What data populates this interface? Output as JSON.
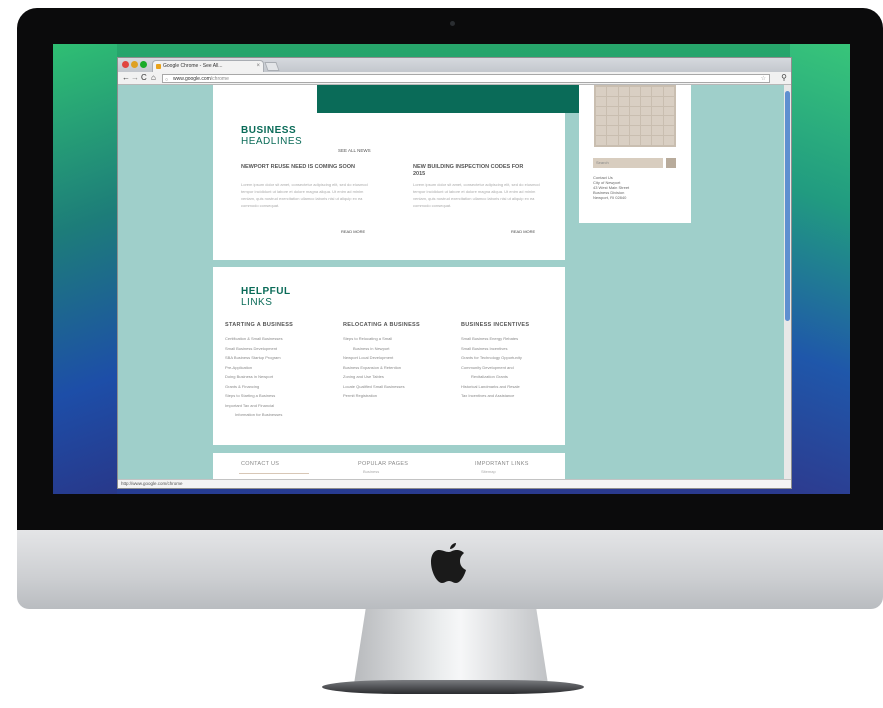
{
  "browser": {
    "tab_title": "Google Chrome - See All...",
    "url_host": "www.google.com",
    "url_path": "/chrome",
    "status_url": "http://www.google.com/chrome"
  },
  "headlines": {
    "title_bold": "BUSINESS",
    "title_light": "HEADLINES",
    "see_all": "SEE ALL NEWS",
    "articles": [
      {
        "title": "NEWPORT REUSE NEED IS COMING SOON",
        "body": "Lorem ipsum dolor sit amet, consectetur adipiscing elit, sed do eiusmod tempor incididunt ut labore et dolore magna aliqua. Ut enim ad minim veniam, quis nostrud exercitation ullamco laboris nisi ut aliquip ex ea commodo consequat.",
        "read_more": "READ MORE"
      },
      {
        "title": "NEW BUILDING INSPECTION CODES FOR 2015",
        "body": "Lorem ipsum dolor sit amet, consectetur adipiscing elit, sed do eiusmod tempor incididunt ut labore et dolore magna aliqua. Ut enim ad minim veniam, quis nostrud exercitation ullamco laboris nisi ut aliquip ex ea commodo consequat.",
        "read_more": "READ MORE"
      }
    ]
  },
  "helpful": {
    "title_bold": "HELPFUL",
    "title_light": "LINKS",
    "columns": [
      {
        "title": "STARTING A BUSINESS",
        "links": [
          "Certification & Small Businesses",
          "Small Business Development",
          "SBA Business Startup Program",
          "Pre-Application",
          "Doing Business in Newport",
          "Grants & Financing",
          "Steps to Starting a Business",
          "Important Tax and Financial",
          "Information for Businesses"
        ]
      },
      {
        "title": "RELOCATING A BUSINESS",
        "links": [
          "Steps to Relocating a Small",
          "Business in Newport",
          "Newport Local Development",
          "Business Expansion & Retention",
          "Zoning and Use Tables",
          "Locate Qualified Small Businesses",
          "Permit Registration"
        ]
      },
      {
        "title": "BUSINESS INCENTIVES",
        "links": [
          "Small Business Energy Rebates",
          "Small Business Incentives",
          "Grants for Technology Opportunity",
          "Community Development and",
          "Revitalization Grants",
          "Historical Landmarks and Resale",
          "Tax Incentives and Assistance"
        ]
      }
    ]
  },
  "footer": {
    "contact": "CONTACT US",
    "popular": "POPULAR PAGES",
    "popular_sub": "Business",
    "important": "IMPORTANT LINKS",
    "important_sub": "Sitemap"
  },
  "sidebar": {
    "search_placeholder": "Search",
    "contact_lines": [
      "Contact Us",
      "City of Newport",
      "43 West Main Street",
      "Business Division",
      "Newport, RI 02840"
    ]
  },
  "colors": {
    "brand_green": "#0a6b58",
    "page_bg": "#9fcfca"
  }
}
